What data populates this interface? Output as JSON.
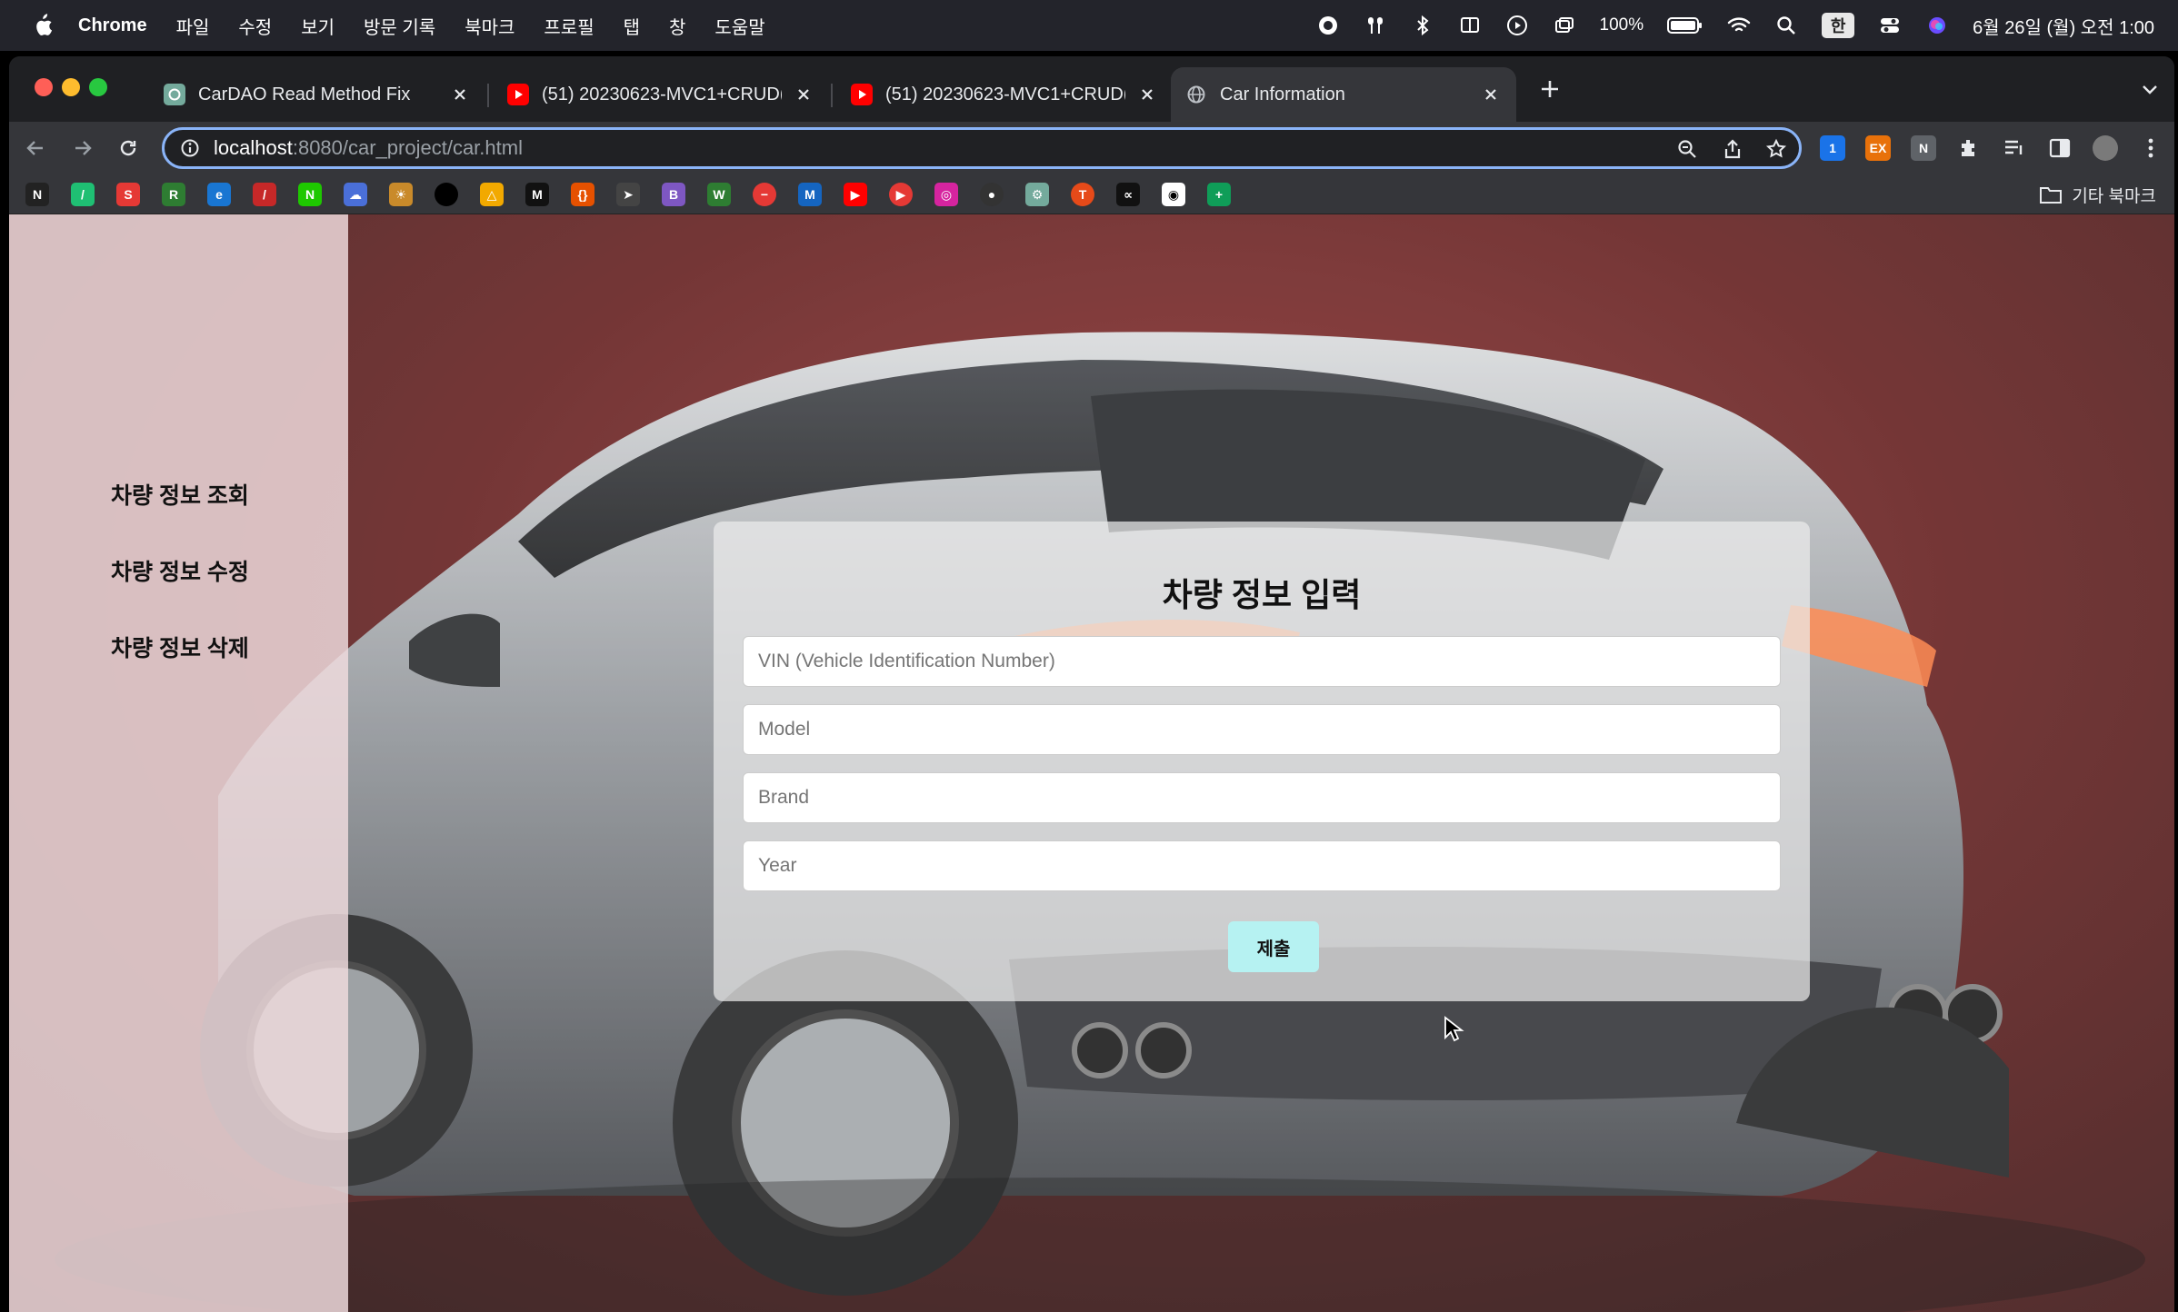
{
  "menubar": {
    "app_name": "Chrome",
    "menus": [
      "파일",
      "수정",
      "보기",
      "방문 기록",
      "북마크",
      "프로필",
      "탭",
      "창",
      "도움말"
    ],
    "battery": "100%",
    "ime": "한",
    "clock": "6월 26일 (월) 오전 1:00"
  },
  "tabs": [
    {
      "title": "CarDAO Read Method Fix",
      "favicon": "chatgpt-icon"
    },
    {
      "title": "(51) 20230623-MVC1+CRUD(",
      "favicon": "youtube-icon"
    },
    {
      "title": "(51) 20230623-MVC1+CRUD(",
      "favicon": "youtube-icon"
    },
    {
      "title": "Car Information",
      "favicon": "globe-icon"
    }
  ],
  "address_bar": {
    "host": "localhost",
    "path": ":8080/car_project/car.html"
  },
  "bookmarks": {
    "other_label": "기타 북마크"
  },
  "sidebar": {
    "links": [
      "차량 정보 조회",
      "차량 정보 수정",
      "차량 정보 삭제"
    ]
  },
  "form": {
    "title": "차량 정보 입력",
    "fields": [
      {
        "placeholder": "VIN (Vehicle Identification Number)",
        "value": ""
      },
      {
        "placeholder": "Model",
        "value": ""
      },
      {
        "placeholder": "Brand",
        "value": ""
      },
      {
        "placeholder": "Year",
        "value": ""
      }
    ],
    "submit_label": "제출"
  },
  "colors": {
    "submit_bg": "#b6f2f2",
    "omnibox_focus": "#8ab4f8",
    "backdrop": "#5e1616"
  }
}
